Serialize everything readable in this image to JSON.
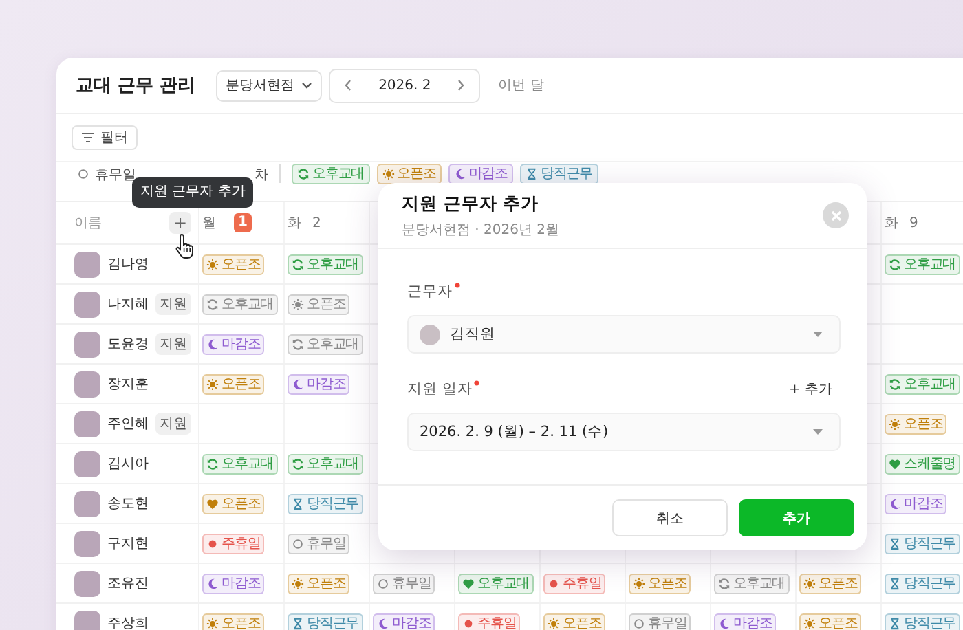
{
  "header": {
    "title": "교대 근무 관리",
    "branch": "분당서현점",
    "month": "2026. 2",
    "today_link": "이번 달"
  },
  "filter": {
    "label": "필터"
  },
  "legend": [
    {
      "kind": "off",
      "label": "휴무일"
    },
    {
      "kind": "text",
      "label": "차"
    },
    {
      "kind": "sync",
      "color": "#2f9e44",
      "label": "오후교대"
    },
    {
      "kind": "sun",
      "color": "#c07f0a",
      "label": "오픈조"
    },
    {
      "kind": "moon",
      "color": "#8e5bd0",
      "label": "마감조"
    },
    {
      "kind": "hourglass",
      "color": "#3f8aa8",
      "label": "당직근무"
    }
  ],
  "tooltip": "지원 근무자 추가",
  "table": {
    "name_heading": "이름",
    "add_label": "+",
    "columns": [
      {
        "weekday": "월",
        "date": "1",
        "today": true
      },
      {
        "weekday": "화",
        "date": "2",
        "today": false
      },
      null,
      null,
      null,
      null,
      null,
      null,
      {
        "weekday": "화",
        "date": "9",
        "today": false
      }
    ],
    "rows": [
      {
        "name": "김나영",
        "cells": [
          {
            "label": "오픈조",
            "kind": "sun",
            "color": "#c07f0a"
          },
          {
            "label": "오후교대",
            "kind": "sync",
            "color": "#2f9e44"
          },
          null,
          null,
          null,
          null,
          null,
          null,
          {
            "label": "오후교대",
            "kind": "sync",
            "color": "#2f9e44"
          }
        ]
      },
      {
        "name": "나지혜",
        "tag": "지원",
        "cells": [
          {
            "label": "오후교대",
            "kind": "sync",
            "color": "#8a8a8a"
          },
          {
            "label": "오픈조",
            "kind": "sun",
            "color": "#8a8a8a"
          },
          null,
          null,
          null,
          null,
          null,
          null,
          null
        ]
      },
      {
        "name": "도윤경",
        "tag": "지원",
        "cells": [
          {
            "label": "마감조",
            "kind": "moon",
            "color": "#8e5bd0"
          },
          {
            "label": "오후교대",
            "kind": "sync",
            "color": "#8a8a8a"
          },
          null,
          null,
          null,
          null,
          null,
          null,
          null
        ]
      },
      {
        "name": "장지훈",
        "cells": [
          {
            "label": "오픈조",
            "kind": "sun",
            "color": "#c07f0a"
          },
          {
            "label": "마감조",
            "kind": "moon",
            "color": "#8e5bd0"
          },
          null,
          null,
          null,
          null,
          null,
          null,
          {
            "label": "오후교대",
            "kind": "sync",
            "color": "#2f9e44"
          }
        ]
      },
      {
        "name": "주인혜",
        "tag": "지원",
        "cells": [
          null,
          null,
          null,
          null,
          null,
          null,
          null,
          null,
          {
            "label": "오픈조",
            "kind": "sun",
            "color": "#c07f0a"
          }
        ]
      },
      {
        "name": "김시아",
        "cells": [
          {
            "label": "오후교대",
            "kind": "sync",
            "color": "#2f9e44"
          },
          {
            "label": "오후교대",
            "kind": "sync",
            "color": "#2f9e44"
          },
          null,
          null,
          null,
          null,
          null,
          null,
          {
            "label": "스케줄명",
            "kind": "heart",
            "color": "#2f9e44"
          }
        ]
      },
      {
        "name": "송도현",
        "cells": [
          {
            "label": "오픈조",
            "kind": "heart",
            "color": "#c07f0a"
          },
          {
            "label": "당직근무",
            "kind": "hourglass",
            "color": "#3f8aa8"
          },
          null,
          null,
          null,
          null,
          null,
          null,
          {
            "label": "마감조",
            "kind": "moon",
            "color": "#8e5bd0"
          }
        ]
      },
      {
        "name": "구지현",
        "cells": [
          {
            "label": "주휴일",
            "kind": "dot",
            "color": "#e5534b"
          },
          {
            "label": "휴무일",
            "kind": "circle",
            "color": "#8a8a8a"
          },
          null,
          null,
          null,
          null,
          null,
          null,
          {
            "label": "당직근무",
            "kind": "hourglass",
            "color": "#3f8aa8"
          }
        ]
      },
      {
        "name": "조유진",
        "cells": [
          {
            "label": "마감조",
            "kind": "moon",
            "color": "#8e5bd0"
          },
          {
            "label": "오픈조",
            "kind": "sun",
            "color": "#c07f0a"
          },
          {
            "label": "휴무일",
            "kind": "circle",
            "color": "#8a8a8a"
          },
          {
            "label": "오후교대",
            "kind": "heart",
            "color": "#2f9e44"
          },
          {
            "label": "주휴일",
            "kind": "dot",
            "color": "#e5534b"
          },
          {
            "label": "오픈조",
            "kind": "sun",
            "color": "#c07f0a"
          },
          {
            "label": "오후교대",
            "kind": "sync",
            "color": "#8a8a8a"
          },
          {
            "label": "오픈조",
            "kind": "sun",
            "color": "#c07f0a"
          },
          {
            "label": "당직근무",
            "kind": "hourglass",
            "color": "#3f8aa8"
          }
        ]
      },
      {
        "name": "주상희",
        "cells": [
          {
            "label": "오픈조",
            "kind": "sun",
            "color": "#c07f0a"
          },
          {
            "label": "당직근무",
            "kind": "hourglass",
            "color": "#3f8aa8"
          },
          {
            "label": "마감조",
            "kind": "moon",
            "color": "#8e5bd0"
          },
          {
            "label": "주휴일",
            "kind": "dot",
            "color": "#e5534b"
          },
          {
            "label": "오픈조",
            "kind": "sun",
            "color": "#c07f0a"
          },
          {
            "label": "휴무일",
            "kind": "circle",
            "color": "#8a8a8a"
          },
          {
            "label": "마감조",
            "kind": "moon",
            "color": "#8e5bd0"
          },
          {
            "label": "오픈조",
            "kind": "sun",
            "color": "#c07f0a"
          },
          {
            "label": "당직근무",
            "kind": "hourglass",
            "color": "#3f8aa8"
          }
        ]
      }
    ]
  },
  "modal": {
    "title": "지원 근무자 추가",
    "subtitle": "분당서현점 · 2026년 2월",
    "fields": [
      {
        "label": "근무자",
        "required": true,
        "avatar": true,
        "value": "김직원"
      },
      {
        "label": "지원 일자",
        "required": true,
        "action": "+ 추가",
        "value": "2026. 2. 9 (월) – 2. 11 (수)"
      }
    ],
    "buttons": [
      {
        "label": "취소",
        "kind": "secondary"
      },
      {
        "label": "추가",
        "kind": "primary"
      }
    ]
  }
}
